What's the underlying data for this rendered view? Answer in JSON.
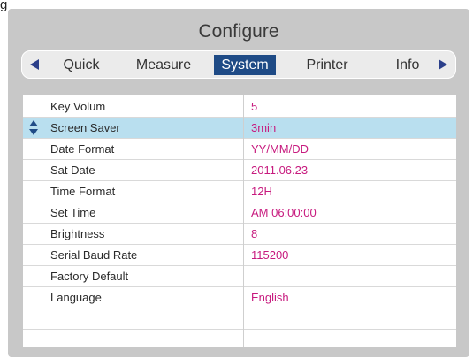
{
  "header_fragment": "g",
  "screen": {
    "title": "Configure"
  },
  "tabs": {
    "items": [
      {
        "label": "Quick",
        "active": false
      },
      {
        "label": "Measure",
        "active": false
      },
      {
        "label": "System",
        "active": true
      },
      {
        "label": "Printer",
        "active": false
      },
      {
        "label": "Info",
        "active": false
      }
    ]
  },
  "settings": {
    "rows": [
      {
        "label": "Key Volum",
        "value": "5"
      },
      {
        "label": "Screen Saver",
        "value": "3min",
        "selected": true
      },
      {
        "label": "Date Format",
        "value": "YY/MM/DD"
      },
      {
        "label": "Sat Date",
        "value": "2011.06.23"
      },
      {
        "label": "Time Format",
        "value": "12H"
      },
      {
        "label": "Set Time",
        "value": "AM 06:00:00"
      },
      {
        "label": "Brightness",
        "value": "8"
      },
      {
        "label": "Serial Baud Rate",
        "value": "115200"
      },
      {
        "label": "Factory Default",
        "value": ""
      },
      {
        "label": "Language",
        "value": "English"
      },
      {
        "label": "",
        "value": ""
      }
    ]
  },
  "colors": {
    "frame": "#c8c8c8",
    "tab_active": "#1f4b86",
    "value_text": "#c71a7e",
    "selected_row": "#b9dfef",
    "arrows": "#2b3f8a"
  },
  "icons": {
    "tab_prev": "triangle-left-icon",
    "tab_next": "triangle-right-icon",
    "row_selector": "up-down-arrows-icon"
  }
}
